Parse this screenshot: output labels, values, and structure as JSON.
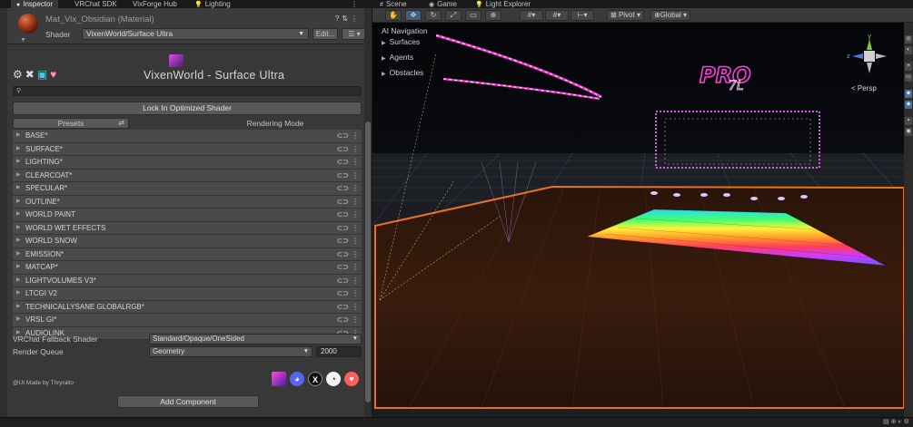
{
  "tabs": {
    "inspector": "Inspector",
    "vrchat_sdk": "VRChat SDK",
    "vixforge_hub": "VixForge Hub",
    "lighting": "Lighting",
    "scene": "Scene",
    "game": "Game",
    "light_explorer": "Light Explorer"
  },
  "material": {
    "name": "Mat_Vix_Obsidian (Material)",
    "shader_label": "Shader",
    "shader_value": "VixenWorld/Surface Ultra",
    "edit_label": "Edit...",
    "list_label": "☰ ▾"
  },
  "shader_title": "VixenWorld - Surface Ultra",
  "lock_button": "Lock In Optimized Shader",
  "presets_label": "Presets",
  "rendering_mode_label": "Rendering Mode",
  "sections": [
    "BASE*",
    "SURFACE*",
    "LIGHTING*",
    "CLEARCOAT*",
    "SPECULAR*",
    "OUTLINE*",
    "WORLD PAINT",
    "WORLD WET EFFECTS",
    "WORLD SNOW",
    "EMISSION*",
    "MATCAP*",
    "LIGHTVOLUMES V3*",
    "LTCGI V2",
    "TECHNICALLYSANE GLOBALRGB*",
    "VRSL GI*",
    "AUDIOLINK"
  ],
  "fallback": {
    "label": "VRChat Fallback Shader",
    "value": "Standard/Opaque/OneSided"
  },
  "render_queue": {
    "label": "Render Queue",
    "value": "Geometry",
    "number": "2000"
  },
  "credit": "@UI Made by Thryrallo",
  "add_component": "Add Component",
  "scene_toolbar": {
    "pivot": "Pivot",
    "global": "Global"
  },
  "ai_navigation": {
    "title": "AI Navigation",
    "items": [
      "Surfaces",
      "Agents",
      "Obstacles"
    ]
  },
  "persp_label": "< Persp",
  "gizmo": {
    "y": "y",
    "z": "z"
  },
  "colors": {
    "accent_orange": "#e8731c",
    "neon_pink": "#ff3cd8",
    "selection_blue": "#3f6fa5"
  }
}
